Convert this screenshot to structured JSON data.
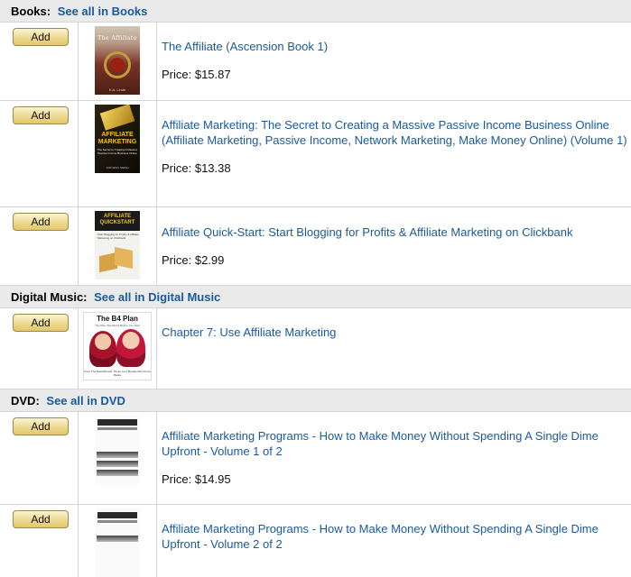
{
  "categories": [
    {
      "name": "Books:",
      "see_all": "See all in Books",
      "items": [
        {
          "add": "Add",
          "title": "The Affiliate (Ascension Book 1)",
          "price": "Price: $15.87",
          "cover": {
            "title": "The Affiliate",
            "author": "K.A. Linde"
          }
        },
        {
          "add": "Add",
          "title": "Affiliate Marketing: The Secret to Creating a Massive Passive Income Business Online (Affiliate Marketing, Passive Income, Network Marketing, Make Money Online) (Volume 1)",
          "price": "Price: $13.38",
          "cover": {
            "title": "AFFILIATE MARKETING",
            "subtitle": "The Secret to Creating A Massive Passive Income Business Online",
            "author": "ANTHONY SMITH"
          }
        },
        {
          "add": "Add",
          "title": "Affiliate Quick-Start: Start Blogging for Profits & Affiliate Marketing on Clickbank",
          "price": "Price: $2.99",
          "cover": {
            "title": "AFFILIATE QUICKSTART",
            "subtitle": "Start Blogging for Profits & Affiliate Marketing on Clickbank"
          }
        }
      ]
    },
    {
      "name": "Digital Music:",
      "see_all": "See all in Digital Music",
      "items": [
        {
          "add": "Add",
          "title": "Chapter 7: Use Affiliate Marketing",
          "cover": {
            "title": "The B4 Plan",
            "subtitle": "The Plan that Works Before You Start",
            "footer": "From The Book Broads: These Lucy Broads Who Know Books"
          }
        }
      ]
    },
    {
      "name": "DVD:",
      "see_all": "See all in DVD",
      "items": [
        {
          "add": "Add",
          "title": "Affiliate Marketing Programs - How to Make Money Without Spending A Single Dime Upfront - Volume 1 of 2",
          "price": "Price: $14.95"
        },
        {
          "add": "Add",
          "title": "Affiliate Marketing Programs - How to Make Money Without Spending A Single Dime Upfront - Volume 2 of 2"
        }
      ]
    }
  ]
}
